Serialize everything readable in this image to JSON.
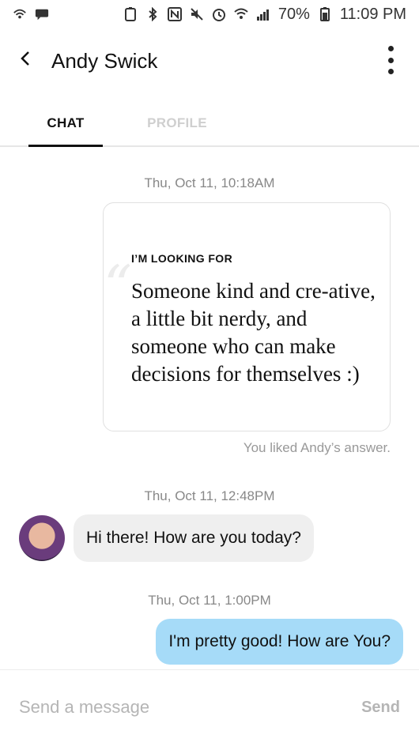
{
  "status_bar": {
    "battery": "70%",
    "time": "11:09 PM",
    "icons": [
      "wifi-call-icon",
      "message-icon",
      "battery-saver-icon",
      "bluetooth-icon",
      "nfc-icon",
      "mute-icon",
      "alarm-icon",
      "wifi-icon",
      "signal-icon",
      "battery-icon"
    ]
  },
  "header": {
    "title": "Andy Swick",
    "back_icon": "back-arrow-icon",
    "menu_icon": "kebab-menu-icon"
  },
  "tabs": [
    {
      "label": "CHAT",
      "active": true
    },
    {
      "label": "PROFILE",
      "active": false
    }
  ],
  "messages": {
    "ts1": "Thu, Oct 11, 10:18AM",
    "card_label": "I’M LOOKING FOR",
    "card_text": "Someone kind and cre-ative, a little bit nerdy, and someone who can make decisions for themselves :)",
    "liked_note": "You liked Andy’s answer.",
    "ts2": "Thu, Oct 11, 12:48PM",
    "incoming": "Hi there! How are you today?",
    "ts3": "Thu, Oct 11, 1:00PM",
    "outgoing": "I'm pretty good! How are You?"
  },
  "composer": {
    "placeholder": "Send a message",
    "send_label": "Send"
  },
  "colors": {
    "outgoing_bubble": "#a6dbf8",
    "incoming_bubble": "#efefef",
    "active_tab": "#111111",
    "inactive_tab": "#cfcfcf"
  }
}
